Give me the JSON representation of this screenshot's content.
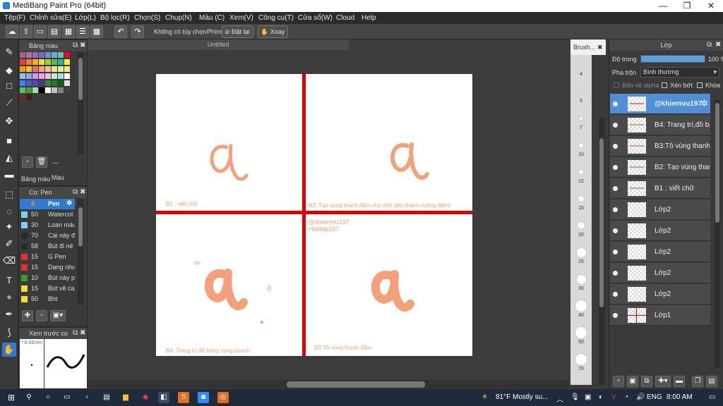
{
  "window": {
    "title": "MediBang Paint Pro (64bit)",
    "controls": [
      "—",
      "❐",
      "✕"
    ]
  },
  "menu": [
    "Tệp(F)",
    "Chỉnh sửa(E)",
    "Lớp(L)",
    "Bộ lọc(R)",
    "Chọn(S)",
    "Chụp(N)",
    "Màu (C)",
    "Xem(V)",
    "Công cụ(T)",
    "Cửa sổ(W)",
    "Cloud",
    "Help"
  ],
  "toolbar": {
    "no_options": "Không có tùy chọn",
    "key_label": "Phím",
    "reset_label": "Đặt lại",
    "rotate_label": "Xoay"
  },
  "palette_panel": {
    "title": "Bảng màu",
    "footer_text": "---",
    "tabs": [
      "Bảng màu",
      "Màu"
    ],
    "colors": [
      [
        "#a86090",
        "#b070a0",
        "#9070b0",
        "#7070c0",
        "#7090d0",
        "#70b0d0",
        "#70c0b0",
        "#e01020"
      ],
      [
        "#e04040",
        "#f08030",
        "#f0b030",
        "#f0e030",
        "#a0d030",
        "#50c050",
        "#30b0a0",
        "#f0f040"
      ],
      [
        "#f0a000",
        "#f0c040",
        "#f07070",
        "#f0a0a0",
        "#f0c0a0",
        "#f0e0a0",
        "#e0f0a0",
        "#f0f080"
      ],
      [
        "#90c0f0",
        "#a0a0f0",
        "#c0a0f0",
        "#f0a0f0",
        "#f0c0e0",
        "#c0f0c0",
        "#a0e0f0",
        "#ffffff"
      ],
      [
        "#4080f0",
        "#4060c0",
        "#6040c0",
        "#404080",
        "#408040",
        "#208020",
        "#106010",
        "#e0e0e0"
      ],
      [
        "#60c060",
        "#40a040",
        "#a0e0a0",
        "#000000",
        "#ffffff",
        "#c0c0c0",
        "#808080",
        "#404040"
      ],
      [
        "#603020",
        "#402010"
      ]
    ]
  },
  "brush_panel": {
    "title": "Cọ: Pen",
    "brushes": [
      {
        "size": "5",
        "name": "Pen",
        "color": "#2f7bd0",
        "selected": true
      },
      {
        "size": "50",
        "name": "Watercol",
        "color": "#7fd0f0"
      },
      {
        "size": "30",
        "name": "Loan màu",
        "color": "#7fd0f0"
      },
      {
        "size": "70",
        "name": "Cái này đ",
        "color": "#2a2a2a"
      },
      {
        "size": "58",
        "name": "Bút đi né",
        "color": "#2a2a2a"
      },
      {
        "size": "15",
        "name": "G Pen",
        "color": "#e03030"
      },
      {
        "size": "15",
        "name": "Dạng nhu",
        "color": "#e03030"
      },
      {
        "size": "10",
        "name": "Bút này p",
        "color": "#30a030"
      },
      {
        "size": "15",
        "name": "Bút vẽ ca",
        "color": "#f0e030"
      },
      {
        "size": "50",
        "name": "Bht",
        "color": "#f0e030"
      }
    ]
  },
  "preview_panel": {
    "title": "Xem trước cọ",
    "size_label": "* 0.42mm"
  },
  "document": {
    "tab": "Untitled",
    "notes": {
      "b1": "B1 : viết chữ",
      "b2": "B2: Tạo vùng thanh đậm cho chữ (lên thanh xuống đậm)",
      "b3": "B3:Tô vùng thanh đậm",
      "b4": "B4: Trang trí,đồ bóng vùng quanh",
      "credit1": "@khiemvu197",
      "credit2": "Hoidap247"
    },
    "letter": "a",
    "stroke_color": "#f4a07a"
  },
  "size_strip": {
    "title": "Brush...",
    "sizes": [
      "4",
      "5",
      "7",
      "10",
      "12",
      "15",
      "20",
      "25",
      "30",
      "40",
      "50",
      "70"
    ]
  },
  "layer_panel": {
    "title": "Lớp",
    "opacity_label": "Độ trong",
    "opacity_value": "100 %",
    "opacity_percent": 100,
    "blend_label": "Pha trộn",
    "blend_value": "Bình thường",
    "checks": [
      "Bảo vệ alpha",
      "Xén bớt",
      "Khóa"
    ],
    "layers": [
      {
        "name": "@khiemvu197",
        "selected": true
      },
      {
        "name": "B4: Trang trí,đồ bó"
      },
      {
        "name": "B3:Tô vùng thanh"
      },
      {
        "name": "B2: Tạo vùng than"
      },
      {
        "name": "B1 : viết chữ"
      },
      {
        "name": "Lớp2"
      },
      {
        "name": "Lớp2"
      },
      {
        "name": "Lớp2"
      },
      {
        "name": "Lớp2"
      },
      {
        "name": "Lớp2"
      },
      {
        "name": "Lớp1"
      }
    ]
  },
  "taskbar": {
    "weather": "81°F  Mostly su...",
    "lang": "ENG",
    "time": "8:00 AM"
  }
}
